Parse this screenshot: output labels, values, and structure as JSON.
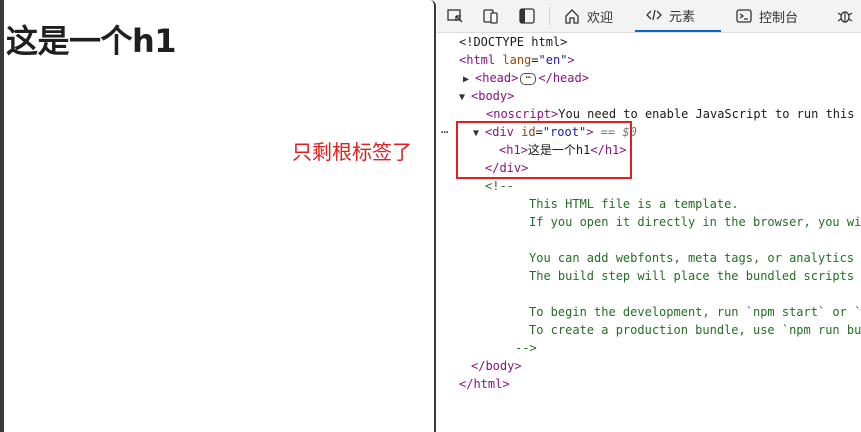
{
  "page": {
    "h1_text": "这是一个h1"
  },
  "annotation": {
    "text": "只剩根标签了"
  },
  "devtools": {
    "tabs": [
      {
        "label": "欢迎",
        "icon": "home-icon"
      },
      {
        "label": "元素",
        "icon": "code-icon",
        "active": true
      },
      {
        "label": "控制台",
        "icon": "console-icon"
      }
    ],
    "dom": {
      "doctype": "<!DOCTYPE html>",
      "html_open_tag": "html",
      "html_lang_attr": "lang",
      "html_lang_val": "\"en\"",
      "head_tag": "head",
      "body_tag": "body",
      "noscript_tag": "noscript",
      "noscript_text": "You need to enable JavaScript to run this",
      "div_tag": "div",
      "div_id_attr": "id",
      "div_id_val": "\"root\"",
      "selected_marker": "== $0",
      "h1_tag": "h1",
      "h1_text": "这是一个h1",
      "comment_open": "<!--",
      "comment_lines": [
        "This HTML file is a template.",
        "If you open it directly in the browser, you wi",
        "",
        "You can add webfonts, meta tags, or analytics",
        "The build step will place the bundled scripts",
        "",
        "To begin the development, run `npm start` or `",
        "To create a production bundle, use `npm run bu"
      ],
      "comment_close": "-->",
      "body_close": "</body>",
      "html_close": "</html>"
    }
  },
  "colors": {
    "accent": "#0a64c8",
    "annotation_red": "#e02020",
    "tag": "#881280",
    "attr": "#994500",
    "value": "#1a1aa6",
    "comment": "#236e25"
  }
}
